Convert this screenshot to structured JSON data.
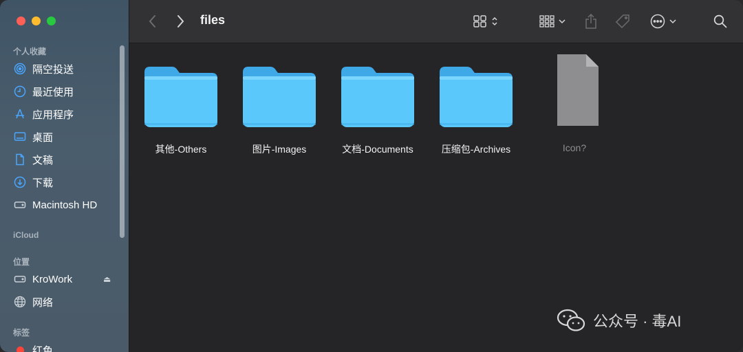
{
  "window": {
    "title": "files"
  },
  "sidebar": {
    "favorites_header": "个人收藏",
    "favorites": [
      {
        "label": "隔空投送",
        "icon": "airdrop-icon"
      },
      {
        "label": "最近使用",
        "icon": "clock-icon"
      },
      {
        "label": "应用程序",
        "icon": "applications-icon"
      },
      {
        "label": "桌面",
        "icon": "desktop-icon"
      },
      {
        "label": "文稿",
        "icon": "document-icon"
      },
      {
        "label": "下载",
        "icon": "download-icon"
      },
      {
        "label": "Macintosh HD",
        "icon": "disk-icon"
      }
    ],
    "icloud_header": "iCloud",
    "locations_header": "位置",
    "locations": [
      {
        "label": "KroWork",
        "icon": "drive-icon"
      },
      {
        "label": "网络",
        "icon": "network-icon"
      }
    ],
    "tags_header": "标签",
    "tags": [
      {
        "label": "红色",
        "color": "#ff453a"
      }
    ]
  },
  "files": [
    {
      "name": "其他-Others",
      "type": "folder"
    },
    {
      "name": "图片-Images",
      "type": "folder"
    },
    {
      "name": "文档-Documents",
      "type": "folder"
    },
    {
      "name": "压缩包-Archives",
      "type": "folder"
    },
    {
      "name": "Icon?",
      "type": "file"
    }
  ],
  "watermark": {
    "text": "公众号 · 毒AI"
  },
  "colors": {
    "folder": "#5ac8fa",
    "accent": "#4aa6ff"
  }
}
